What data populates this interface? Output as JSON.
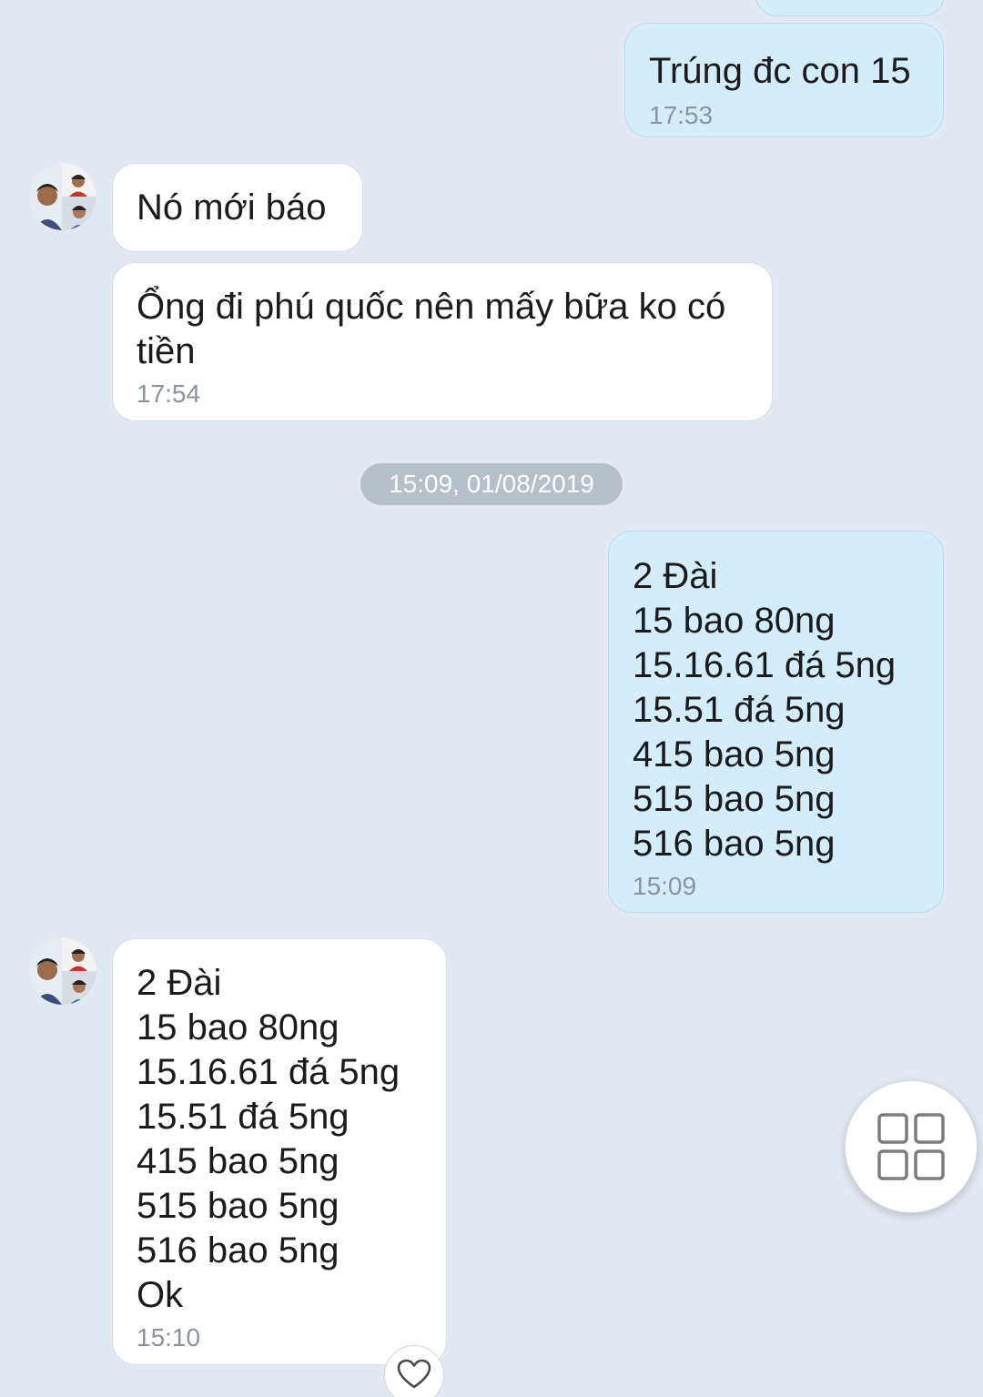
{
  "conversation": {
    "date_separator": "15:09, 01/08/2019",
    "messages": [
      {
        "direction": "out",
        "text": "Trúng đc con 15",
        "time": "17:53"
      },
      {
        "direction": "in",
        "text": "Nó mới báo"
      },
      {
        "direction": "in",
        "text": "Ổng đi phú quốc nên mấy bữa ko có tiền",
        "time": "17:54"
      },
      {
        "direction": "out",
        "text": "2 Đài\n15 bao 80ng\n15.16.61 đá 5ng\n15.51 đá 5ng\n415 bao 5ng\n515 bao 5ng\n516 bao 5ng",
        "time": "15:09"
      },
      {
        "direction": "in",
        "text": "2 Đài\n15 bao 80ng\n15.16.61 đá 5ng\n15.51 đá 5ng\n415 bao 5ng\n515 bao 5ng\n516 bao 5ng\nOk",
        "time": "15:10"
      }
    ]
  },
  "icons": {
    "grid": "grid-icon",
    "heart": "heart-icon",
    "avatar": "avatar"
  },
  "colors": {
    "background": "#e3e9f2",
    "incoming_bubble": "#ffffff",
    "outgoing_bubble": "#d4edfd",
    "timestamp": "#8a939e",
    "date_pill": "#b7bfc9"
  }
}
